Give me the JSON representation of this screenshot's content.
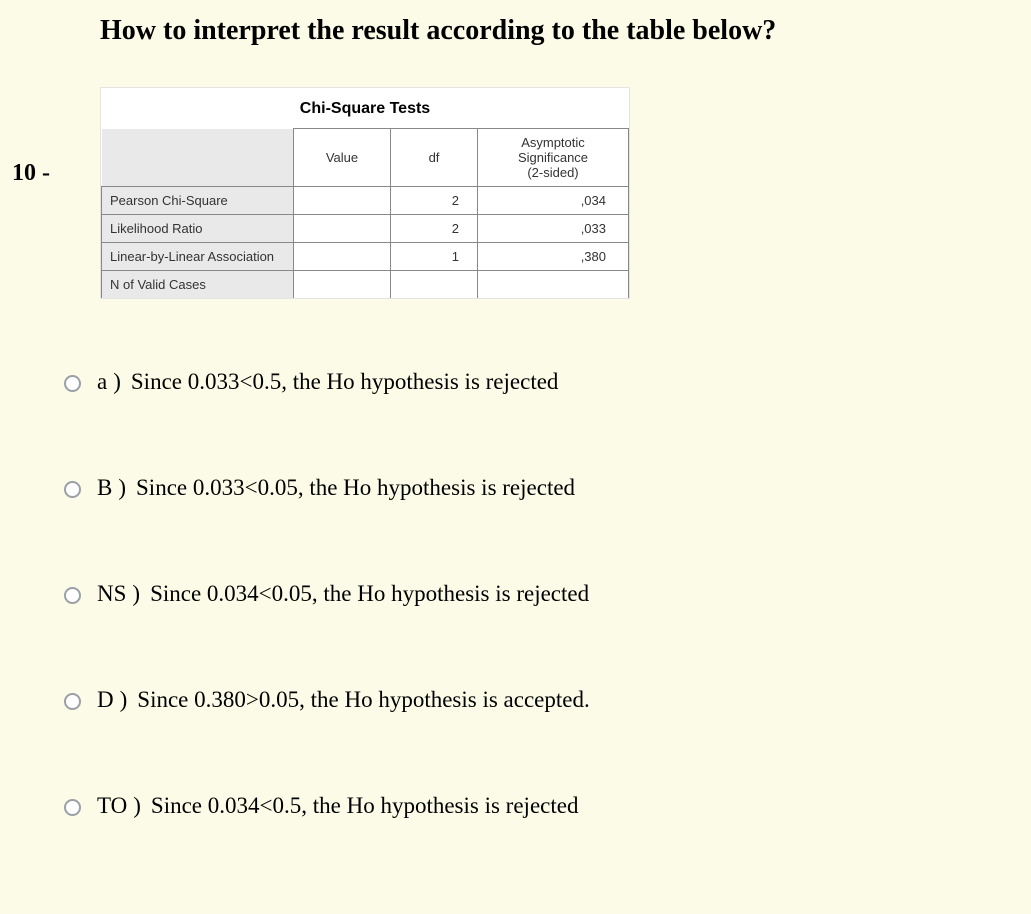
{
  "question": {
    "number_label": "10 -",
    "title": "How to interpret the result according to the table below?"
  },
  "table": {
    "title": "Chi-Square Tests",
    "columns": [
      "Value",
      "df",
      "Asymptotic Significance (2-sided)"
    ],
    "rows": [
      {
        "label": "Pearson Chi-Square",
        "value": "",
        "df": "2",
        "sig": ",034"
      },
      {
        "label": "Likelihood Ratio",
        "value": "",
        "df": "2",
        "sig": ",033"
      },
      {
        "label": "Linear-by-Linear Association",
        "value": "",
        "df": "1",
        "sig": ",380"
      },
      {
        "label": "N of Valid Cases",
        "value": "",
        "df": "",
        "sig": ""
      }
    ]
  },
  "options": [
    {
      "letter": "a",
      "text": "Since 0.033<0.5, the Ho hypothesis is rejected"
    },
    {
      "letter": "B",
      "text": "Since 0.033<0.05, the Ho hypothesis is rejected"
    },
    {
      "letter": "NS",
      "text": "Since 0.034<0.05, the Ho hypothesis is rejected"
    },
    {
      "letter": "D",
      "text": "Since 0.380>0.05, the Ho hypothesis is accepted."
    },
    {
      "letter": "TO",
      "text": "Since 0.034<0.5, the Ho hypothesis is rejected"
    }
  ]
}
